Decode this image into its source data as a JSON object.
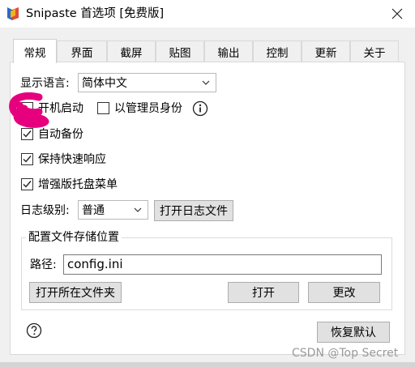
{
  "window": {
    "title": "Snipaste 首选项 [免费版]"
  },
  "tabs": [
    {
      "label": "常规",
      "active": true
    },
    {
      "label": "界面"
    },
    {
      "label": "截屏"
    },
    {
      "label": "贴图"
    },
    {
      "label": "输出"
    },
    {
      "label": "控制"
    },
    {
      "label": "更新"
    },
    {
      "label": "关于"
    }
  ],
  "general": {
    "language_label": "显示语言:",
    "language_value": "简体中文",
    "startup_label": "开机启动",
    "admin_label": "以管理员身份",
    "auto_backup_label": "自动备份",
    "keep_responsive_label": "保持快速响应",
    "enhanced_tray_label": "增强版托盘菜单",
    "log_level_label": "日志级别:",
    "log_level_value": "普通",
    "open_log_button": "打开日志文件",
    "config_group_title": "配置文件存储位置",
    "path_label": "路径:",
    "path_value": "config.ini",
    "open_folder_button": "打开所在文件夹",
    "open_button": "打开",
    "change_button": "更改",
    "restore_defaults_button": "恢复默认",
    "checkboxes": {
      "startup": false,
      "run_as_admin": false,
      "auto_backup": true,
      "keep_responsive": true,
      "enhanced_tray": true
    }
  },
  "watermark": "CSDN @Top Secret",
  "colors": {
    "scribble": "#e6007e",
    "accent": "#0078d7"
  },
  "icons": [
    "snipaste-logo-icon",
    "close-icon",
    "chevron-down-icon",
    "info-icon",
    "help-icon",
    "check-icon"
  ]
}
